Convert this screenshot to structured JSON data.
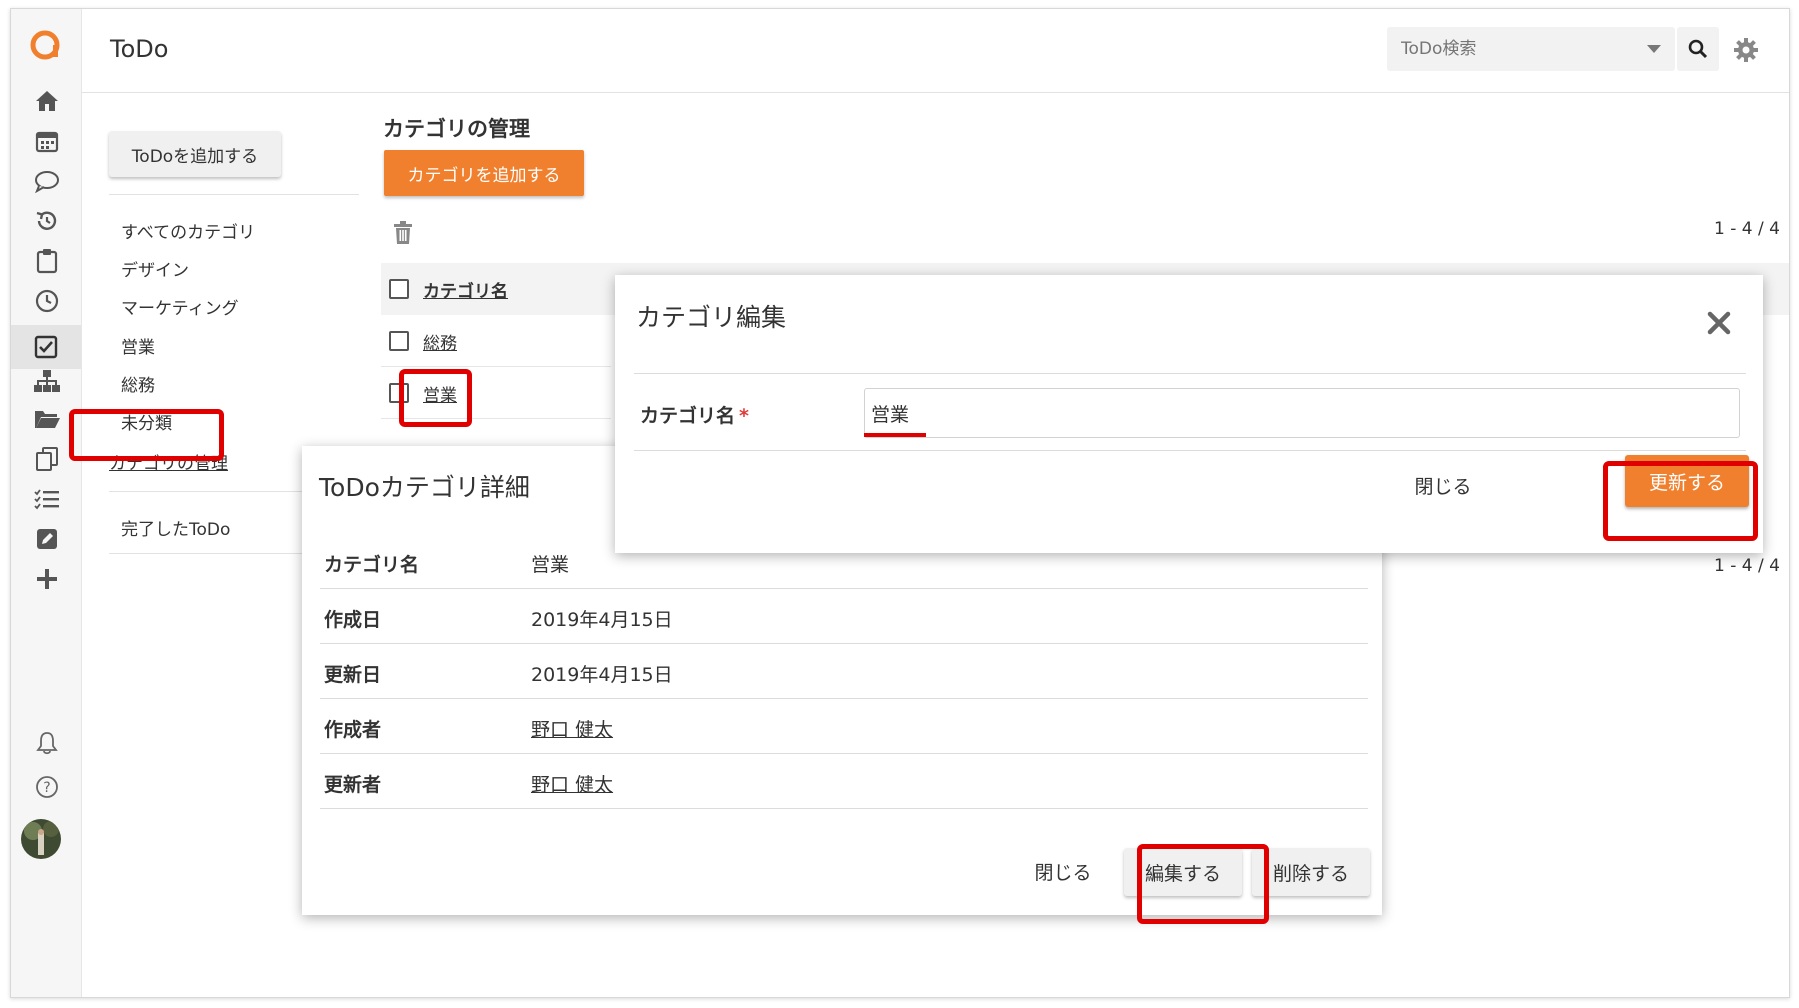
{
  "app": {
    "title": "ToDo"
  },
  "search": {
    "placeholder": "ToDo検索"
  },
  "sidebar": {
    "add_todo_button": "ToDoを追加する",
    "items": [
      "すべてのカテゴリ",
      "デザイン",
      "マーケティング",
      "営業",
      "総務",
      "未分類"
    ],
    "manage_link": "カテゴリの管理",
    "completed": "完了したToDo"
  },
  "main": {
    "title": "カテゴリの管理",
    "add_category_button": "カテゴリを追加する",
    "pager_top": "1 - 4 / 4",
    "pager_bottom": "1 - 4 / 4",
    "table": {
      "header": "カテゴリ名",
      "rows": [
        "総務",
        "営業"
      ]
    }
  },
  "detail_dialog": {
    "title": "ToDoカテゴリ詳細",
    "rows": [
      {
        "key": "カテゴリ名",
        "value": "営業"
      },
      {
        "key": "作成日",
        "value": "2019年4月15日"
      },
      {
        "key": "更新日",
        "value": "2019年4月15日"
      },
      {
        "key": "作成者",
        "value": "野口 健太"
      },
      {
        "key": "更新者",
        "value": "野口 健太"
      }
    ],
    "close_button": "閉じる",
    "edit_button": "編集する",
    "delete_button": "削除する"
  },
  "edit_dialog": {
    "title": "カテゴリ編集",
    "field_label": "カテゴリ名",
    "required_mark": "*",
    "field_value": "営業",
    "close_button": "閉じる",
    "update_button": "更新する"
  },
  "colors": {
    "accent": "#f0802e",
    "highlight": "#e00000",
    "logo": "#f0802e"
  },
  "icons": [
    "logo-icon",
    "home-icon",
    "calendar-icon",
    "chat-icon",
    "history-icon",
    "clipboard-icon",
    "clock-icon",
    "todo-check-icon",
    "org-chart-icon",
    "folder-icon",
    "copy-icon",
    "checklist-icon",
    "edit-icon",
    "plus-icon",
    "bell-icon",
    "help-icon",
    "search-icon",
    "gear-icon",
    "trash-icon",
    "close-icon"
  ]
}
